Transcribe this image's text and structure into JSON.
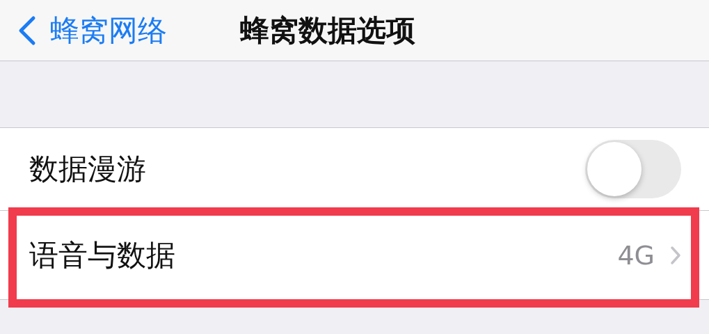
{
  "nav": {
    "back_label": "蜂窝网络",
    "title": "蜂窝数据选项"
  },
  "rows": [
    {
      "kind": "toggle",
      "label": "数据漫游",
      "on": false,
      "highlighted": false
    },
    {
      "kind": "link",
      "label": "语音与数据",
      "value": "4G",
      "highlighted": true
    }
  ]
}
